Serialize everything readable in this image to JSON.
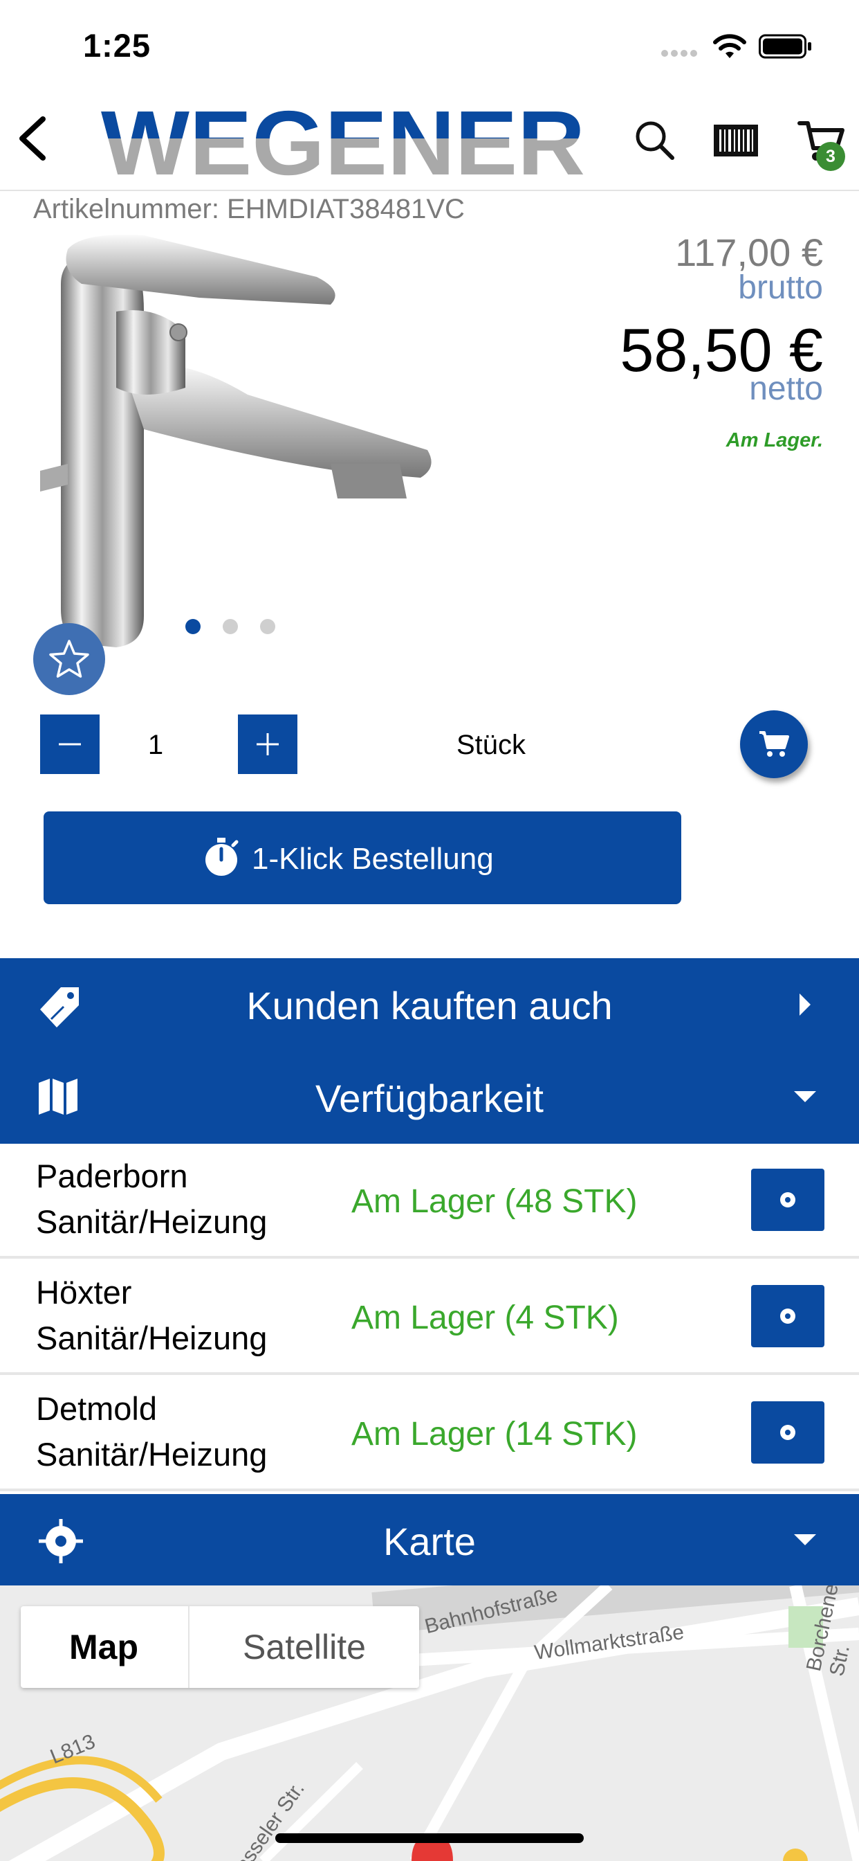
{
  "status_bar": {
    "time": "1:25"
  },
  "nav": {
    "brand": "WEGENER",
    "cart_count": "3"
  },
  "product": {
    "article_number": "Artikelnummer: EHMDIAT38481VC",
    "price_brutto": "117,00 €",
    "label_brutto": "brutto",
    "price_netto": "58,50 €",
    "label_netto": "netto",
    "stock_status": "Am Lager.",
    "image_page": 1,
    "image_pages": 3
  },
  "quantity": {
    "minus": "−",
    "value": "1",
    "plus": "+",
    "unit": "Stück"
  },
  "oneclick": {
    "label": "1-Klick Bestellung"
  },
  "sections": {
    "kunden": "Kunden kauften auch",
    "verfuegbarkeit": "Verfügbarkeit",
    "karte": "Karte"
  },
  "availability": [
    {
      "line1": "Paderborn",
      "line2": "Sanitär/Heizung",
      "stock": "Am Lager (48 STK)"
    },
    {
      "line1": "Höxter",
      "line2": "Sanitär/Heizung",
      "stock": "Am Lager (4 STK)"
    },
    {
      "line1": "Detmold",
      "line2": "Sanitär/Heizung",
      "stock": "Am Lager (14 STK)"
    }
  ],
  "map": {
    "tab_map": "Map",
    "tab_satellite": "Satellite",
    "streets": [
      "Bahnhofstraße",
      "Wollmarktstraße",
      "Borchener Str.",
      "L813",
      "Kasseler Str."
    ]
  },
  "colors": {
    "primary": "#0a4aa0",
    "in_stock": "#3aa82c",
    "badge": "#3a8d33",
    "label_blue": "#6f8fbe"
  }
}
